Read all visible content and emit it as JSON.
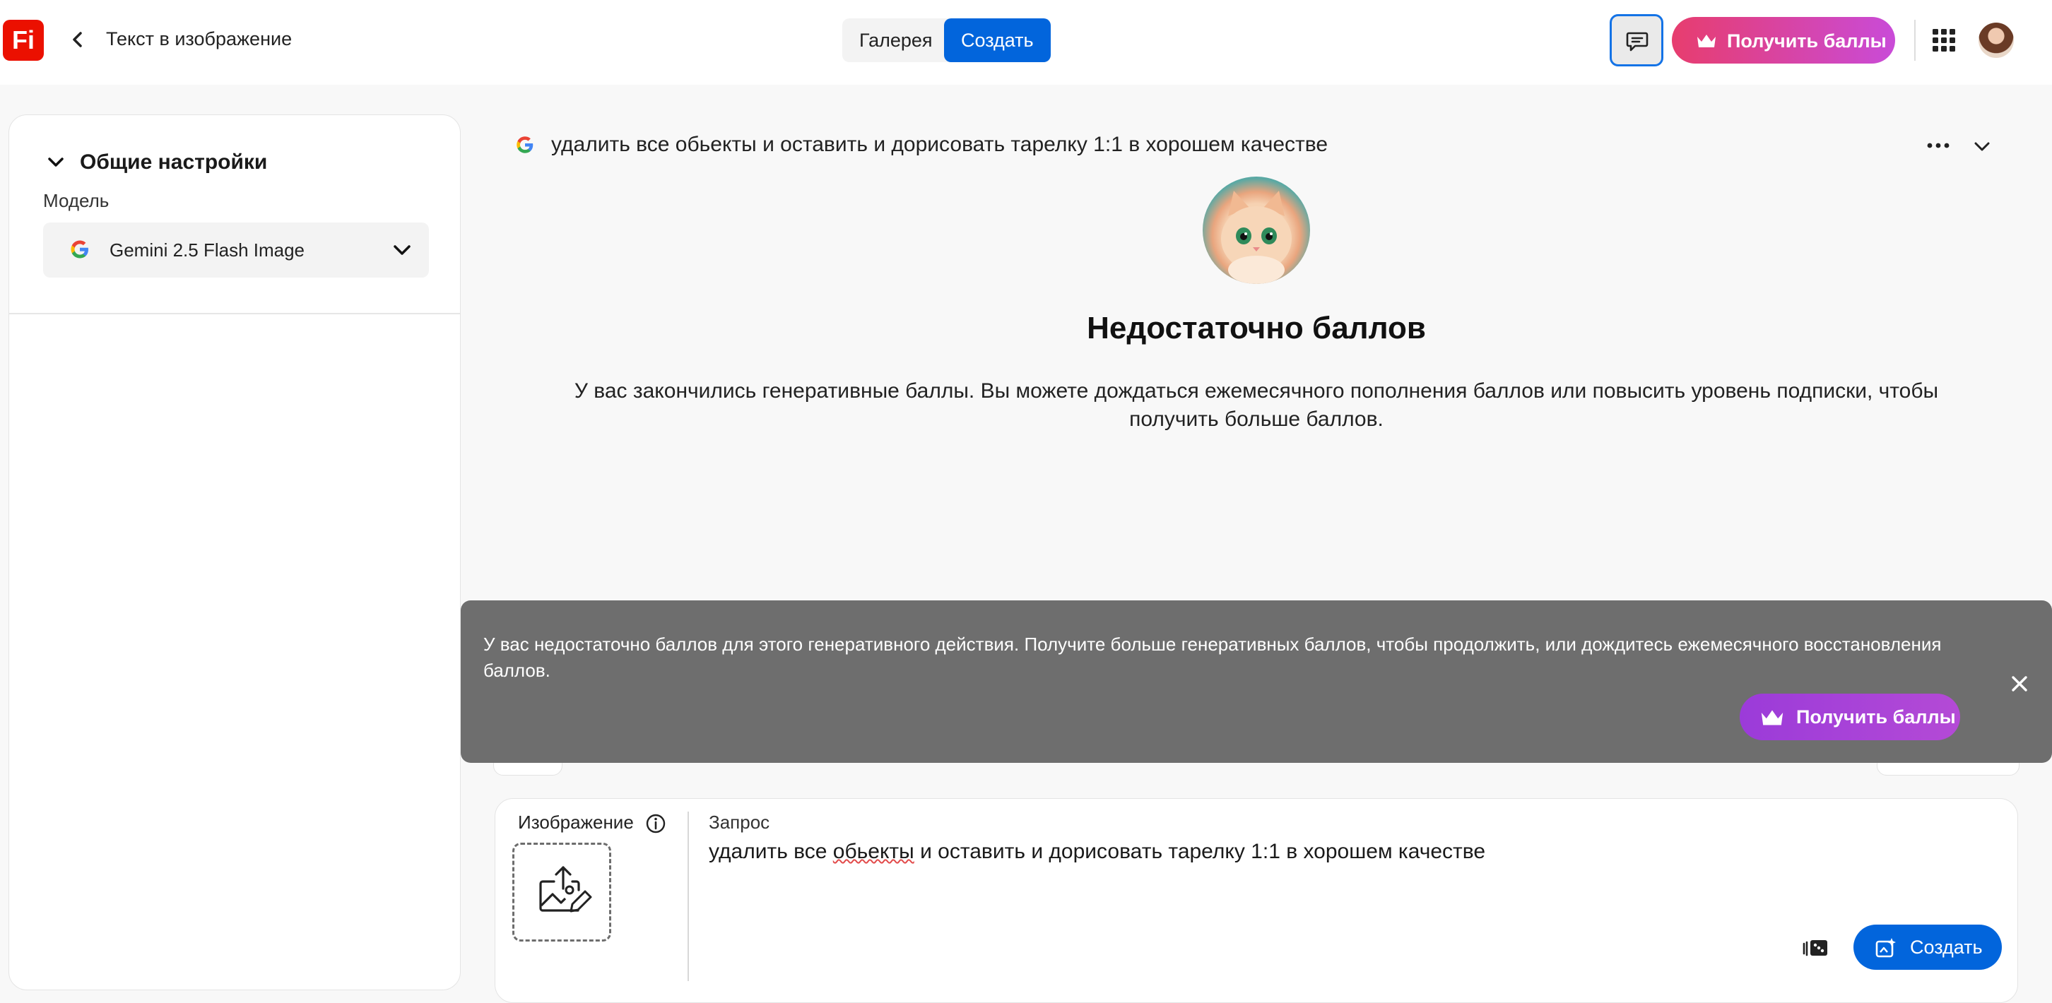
{
  "app": {
    "logo_text": "Fi",
    "title": "Текст в изображение"
  },
  "nav": {
    "tabs": [
      {
        "label": "Галерея",
        "selected": false
      },
      {
        "label": "Создать",
        "selected": true
      }
    ]
  },
  "header": {
    "get_credits_label": "Получить баллы"
  },
  "settings": {
    "section_title": "Общие настройки",
    "model_label": "Модель",
    "model_value": "Gemini 2.5 Flash Image"
  },
  "generation": {
    "prompt": "удалить все обьекты и оставить и дорисовать тарелку 1:1 в хорошем качестве",
    "error_title": "Недостаточно баллов",
    "error_message": "У вас закончились генеративные баллы. Вы можете дождаться ежемесячного пополнения баллов или повысить уровень подписки, чтобы получить больше баллов."
  },
  "toast": {
    "message": "У вас недостаточно баллов для этого генеративного действия. Получите больше генеративных баллов, чтобы продолжить, или дождитесь ежемесячного восстановления баллов.",
    "button_label": "Получить баллы"
  },
  "composer": {
    "image_label": "Изображение",
    "query_label": "Запрос",
    "query_before": "удалить все ",
    "query_misspelled": "обьекты",
    "query_after": " и оставить и дорисовать тарелку 1:1 в хорошем качестве",
    "create_label": "Создать"
  },
  "colors": {
    "brand_red": "#eb1000",
    "accent_blue": "#0265dc",
    "credits_gradient_start": "#e73d6e",
    "credits_gradient_end": "#c94bd8",
    "toast_bg": "#6e6e6e"
  }
}
